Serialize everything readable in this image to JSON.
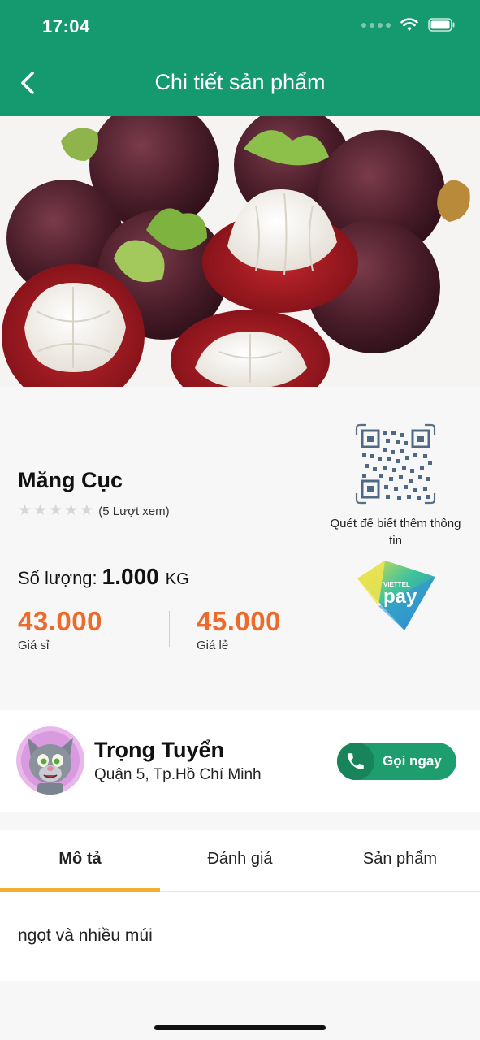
{
  "status_bar": {
    "time": "17:04"
  },
  "header": {
    "title": "Chi tiết sản phẩm",
    "back_icon": "chevron-left-icon"
  },
  "product": {
    "name": "Măng Cục",
    "rating": {
      "stars": 0,
      "max": 5,
      "views_text": "(5 Lượt xem)"
    },
    "quantity": {
      "label": "Số lượng:",
      "value": "1.000",
      "unit": "KG"
    },
    "prices": [
      {
        "value": "43.000",
        "label": "Giá sỉ"
      },
      {
        "value": "45.000",
        "label": "Giá lẻ"
      }
    ],
    "qr_caption": "Quét để biết thêm thông tin",
    "pay_logo": {
      "brand_top": "VIETTEL",
      "brand_main": "pay"
    }
  },
  "seller": {
    "name": "Trọng Tuyển",
    "address": "Quận 5, Tp.Hồ Chí Minh",
    "call_label": "Gọi ngay"
  },
  "tabs": [
    {
      "label": "Mô tả",
      "active": true
    },
    {
      "label": "Đánh giá",
      "active": false
    },
    {
      "label": "Sản phẩm",
      "active": false
    }
  ],
  "description": "ngọt và nhiều múi",
  "colors": {
    "primary": "#149a6e",
    "price": "#ec6a2a",
    "tab_indicator": "#f2b02e"
  }
}
